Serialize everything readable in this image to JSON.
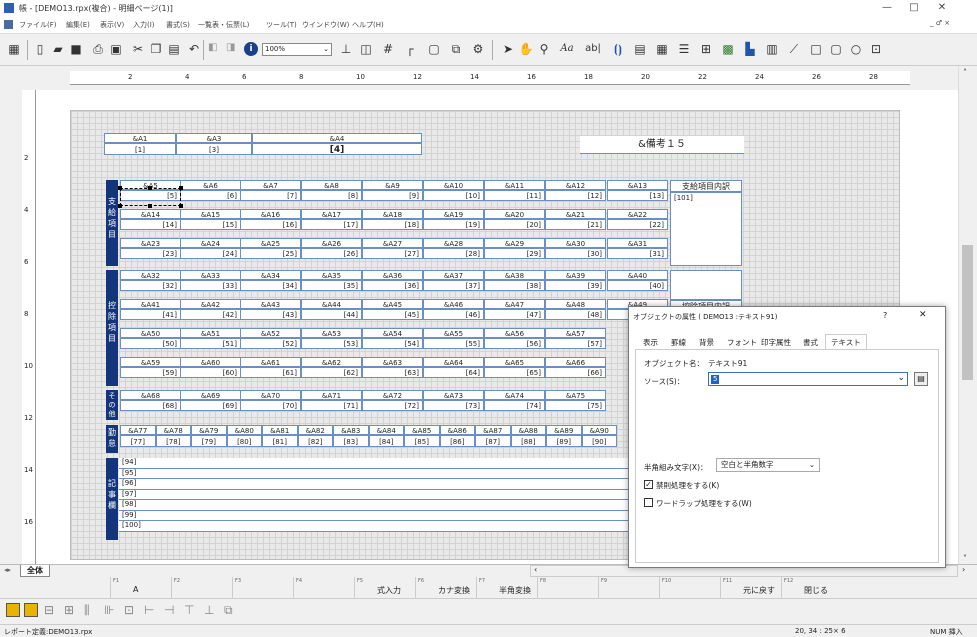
{
  "window": {
    "title": "帳 - [DEMO13.rpx(複合) - 明細ページ(1)]",
    "min": "—",
    "max": "□",
    "close": "✕",
    "child_controls": "_ ♂ ×"
  },
  "menu": [
    "ファイル(F)",
    "編集(E)",
    "表示(V)",
    "入力(I)",
    "書式(S)",
    "一覧表・伝票(L)",
    "ツール(T)",
    "ウインドウ(W)",
    "ヘルプ(H)"
  ],
  "toolbar": {
    "zoom": "100%",
    "text_tool": "Aa",
    "label_tool": "ab|"
  },
  "ruler": [
    "2",
    "4",
    "6",
    "8",
    "10",
    "12",
    "14",
    "16",
    "18",
    "20",
    "22",
    "24",
    "26",
    "28"
  ],
  "vruler": [
    "2",
    "4",
    "6",
    "8",
    "10",
    "12",
    "14",
    "16",
    "18"
  ],
  "header_fields": {
    "top": [
      "&A1",
      "&A3",
      "&A4"
    ],
    "bottom": [
      "[1]",
      "[3]",
      "[4]"
    ],
    "note": "&備考１５"
  },
  "sections": {
    "pay": "支給項目",
    "deduct": "控除項目",
    "other": "その他",
    "attend": "勤怠",
    "notes": "記事欄"
  },
  "pay_rows": [
    {
      "labels": [
        "&A5",
        "&A6",
        "&A7",
        "&A8",
        "&A9",
        "&A10",
        "&A11",
        "&A12",
        "&A13"
      ],
      "values": [
        "[5]",
        "[6]",
        "[7]",
        "[8]",
        "[9]",
        "[10]",
        "[11]",
        "[12]",
        "[13]"
      ]
    },
    {
      "labels": [
        "&A14",
        "&A15",
        "&A16",
        "&A17",
        "&A18",
        "&A19",
        "&A20",
        "&A21",
        "&A22"
      ],
      "values": [
        "[14]",
        "[15]",
        "[16]",
        "[17]",
        "[18]",
        "[19]",
        "[20]",
        "[21]",
        "[22]"
      ]
    },
    {
      "labels": [
        "&A23",
        "&A24",
        "&A25",
        "&A26",
        "&A27",
        "&A28",
        "&A29",
        "&A30",
        "&A31"
      ],
      "values": [
        "[23]",
        "[24]",
        "[25]",
        "[26]",
        "[27]",
        "[28]",
        "[29]",
        "[30]",
        "[31]"
      ]
    }
  ],
  "pay_detail": {
    "title": "支給項目内訳",
    "value": "[101]"
  },
  "deduct_detail": {
    "title": "控除項目内訳"
  },
  "deduct_rows": [
    {
      "labels": [
        "&A32",
        "&A33",
        "&A34",
        "&A35",
        "&A36",
        "&A37",
        "&A38",
        "&A39",
        "&A40"
      ],
      "values": [
        "[32]",
        "[33]",
        "[34]",
        "[35]",
        "[36]",
        "[37]",
        "[38]",
        "[39]",
        "[40]"
      ]
    },
    {
      "labels": [
        "&A41",
        "&A42",
        "&A43",
        "&A44",
        "&A45",
        "&A46",
        "&A47",
        "&A48",
        "&A49"
      ],
      "values": [
        "[41]",
        "[42]",
        "[43]",
        "[44]",
        "[45]",
        "[46]",
        "[47]",
        "[48]",
        "[49]"
      ]
    },
    {
      "labels": [
        "&A50",
        "&A51",
        "&A52",
        "&A53",
        "&A54",
        "&A55",
        "&A56",
        "&A57",
        ""
      ],
      "values": [
        "[50]",
        "[51]",
        "[52]",
        "[53]",
        "[54]",
        "[55]",
        "[56]",
        "[57]",
        ""
      ]
    },
    {
      "labels": [
        "&A59",
        "&A60",
        "&A61",
        "&A62",
        "&A63",
        "&A64",
        "&A65",
        "&A66",
        ""
      ],
      "values": [
        "[59]",
        "[60]",
        "[61]",
        "[62]",
        "[63]",
        "[64]",
        "[65]",
        "[66]",
        ""
      ]
    }
  ],
  "other_row": {
    "labels": [
      "&A68",
      "&A69",
      "&A70",
      "&A71",
      "&A72",
      "&A73",
      "&A74",
      "&A75",
      ""
    ],
    "values": [
      "[68]",
      "[69]",
      "[70]",
      "[71]",
      "[72]",
      "[73]",
      "[74]",
      "[75]",
      ""
    ]
  },
  "attend_row": {
    "labels": [
      "&A77",
      "&A78",
      "&A79",
      "&A80",
      "&A81",
      "&A82",
      "&A83",
      "&A84",
      "&A85",
      "&A86",
      "&A87",
      "&A88",
      "&A89",
      "&A90"
    ],
    "values": [
      "[77]",
      "[78]",
      "[79]",
      "[80]",
      "[81]",
      "[82]",
      "[83]",
      "[84]",
      "[85]",
      "[86]",
      "[87]",
      "[88]",
      "[89]",
      "[90]"
    ]
  },
  "notes": [
    "[94]",
    "[95]",
    "[96]",
    "[97]",
    "[98]",
    "[99]",
    "[100]"
  ],
  "sheet_tab": "全体",
  "fkeys": [
    {
      "n": "F1",
      "l": "A"
    },
    {
      "n": "F2",
      "l": ""
    },
    {
      "n": "F3",
      "l": ""
    },
    {
      "n": "F4",
      "l": ""
    },
    {
      "n": "F5",
      "l": "式入力"
    },
    {
      "n": "F6",
      "l": "カナ変換"
    },
    {
      "n": "F7",
      "l": "半角変換"
    },
    {
      "n": "F8",
      "l": ""
    },
    {
      "n": "F9",
      "l": ""
    },
    {
      "n": "F10",
      "l": ""
    },
    {
      "n": "F11",
      "l": "元に戻す"
    },
    {
      "n": "F12",
      "l": "閉じる"
    }
  ],
  "status": {
    "file": "レポート定義:DEMO13.rpx",
    "pos": "20, 34 : 25× 6",
    "mode": "NUM 挿入"
  },
  "dialog": {
    "title": "オブジェクトの属性 ( DEMO13 :テキスト91)",
    "help": "?",
    "close": "✕",
    "tabs": [
      "表示",
      "罫線",
      "背景",
      "フォント",
      "印字属性",
      "書式",
      "テキスト"
    ],
    "name_label": "オブジェクト名：",
    "name_value": "テキスト91",
    "source_label": "ソース(S)：",
    "source_value": "5",
    "mix_label": "半角組み文字(X)：",
    "mix_value": "空白と半角数字",
    "kinsoku": "禁則処理をする(K)",
    "kinsoku_checked": true,
    "wordwrap": "ワードラップ処理をする(W)",
    "wordwrap_checked": false
  }
}
